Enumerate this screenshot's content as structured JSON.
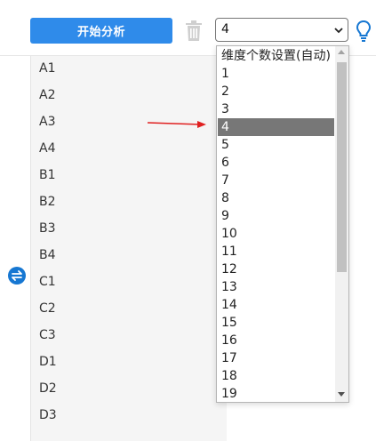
{
  "toolbar": {
    "start_label": "开始分析",
    "select_value": "4"
  },
  "items": [
    "A1",
    "A2",
    "A3",
    "A4",
    "B1",
    "B2",
    "B3",
    "B4",
    "C1",
    "C2",
    "C3",
    "D1",
    "D2",
    "D3"
  ],
  "dropdown": {
    "options": [
      "维度个数设置(自动)",
      "1",
      "2",
      "3",
      "4",
      "5",
      "6",
      "7",
      "8",
      "9",
      "10",
      "11",
      "12",
      "13",
      "14",
      "15",
      "16",
      "17",
      "18",
      "19"
    ],
    "selected": "4"
  },
  "colors": {
    "accent": "#2f8bea",
    "selected_option": "#777777",
    "arrow": "#e02020",
    "icon_blue": "#1677d2"
  },
  "icons": [
    "trash-icon",
    "chevron-down-icon",
    "lightbulb-icon",
    "swap-icon",
    "arrow-icon"
  ]
}
